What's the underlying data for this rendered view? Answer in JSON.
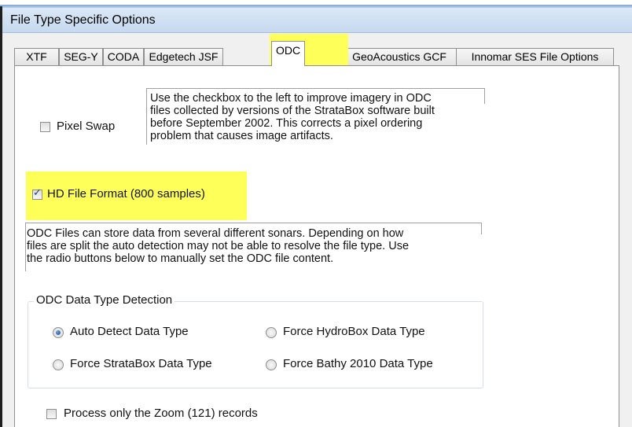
{
  "window": {
    "title": "File Type Specific Options"
  },
  "tabs": [
    {
      "label": "XTF",
      "active": false
    },
    {
      "label": "SEG-Y",
      "active": false
    },
    {
      "label": "CODA",
      "active": false
    },
    {
      "label": "Edgetech JSF",
      "active": false
    },
    {
      "label": "ODC",
      "active": true
    },
    {
      "label": "GeoAcoustics GCF",
      "active": false
    },
    {
      "label": "Innomar SES File Options",
      "active": false
    }
  ],
  "odc": {
    "pixel_swap": {
      "label": "Pixel Swap",
      "checked": false,
      "description_lines": [
        "Use the checkbox to the left to improve imagery in ODC",
        "files collected by versions of the StrataBox software built",
        "before September 2002.  This corrects a pixel ordering",
        "problem that causes image artifacts."
      ]
    },
    "hd_format": {
      "label": "HD File Format (800 samples)",
      "checked": true
    },
    "info_lines": [
      "ODC Files can store data from several different sonars.  Depending on how",
      "files are split the auto detection may not be able to resolve the file type.  Use",
      "the radio buttons below to manually set the ODC file content."
    ],
    "detection_group": {
      "title": "ODC Data Type Detection",
      "options": [
        {
          "label": "Auto Detect Data Type",
          "selected": true
        },
        {
          "label": "Force HydroBox Data Type",
          "selected": false
        },
        {
          "label": "Force StrataBox Data Type",
          "selected": false
        },
        {
          "label": "Force Bathy 2010 Data Type",
          "selected": false
        }
      ]
    },
    "zoom_only": {
      "label": "Process only the Zoom (121) records",
      "checked": false
    }
  },
  "colors": {
    "highlight": "#ffff5a",
    "titlebar": "#c6d9ef",
    "radio_selected": "#10408a",
    "checkmark": "#1a3f7a"
  }
}
